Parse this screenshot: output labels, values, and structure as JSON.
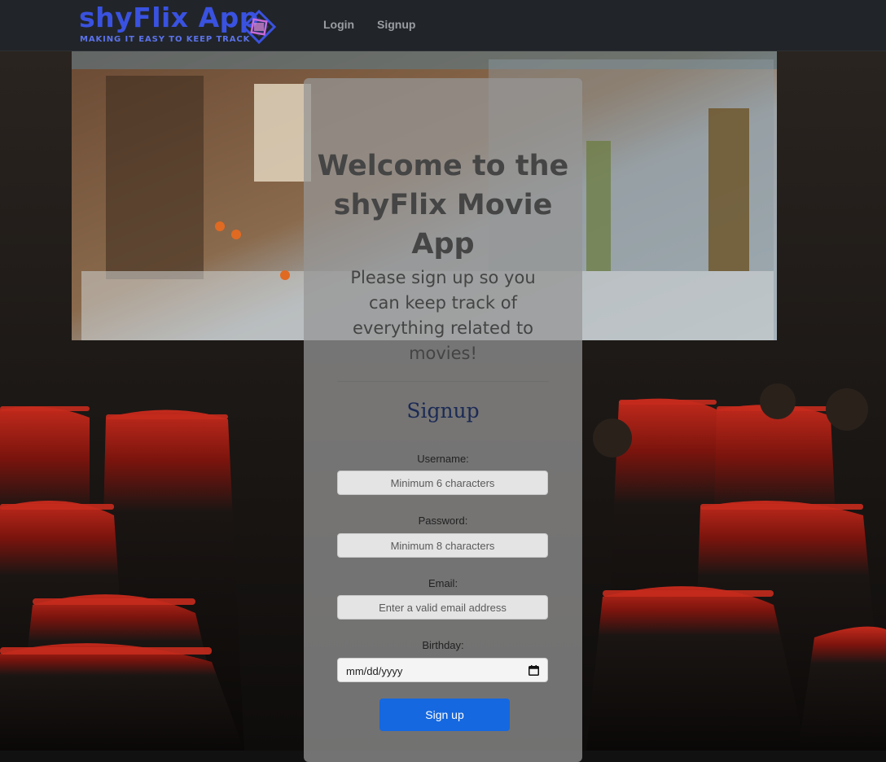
{
  "nav": {
    "brand_name": "shyFlix App",
    "brand_tagline": "MAKING IT EASY TO KEEP TRACK",
    "links": [
      "Login",
      "Signup"
    ]
  },
  "hero": {
    "title": "Welcome to the shyFlix Movie App",
    "subtitle": "Please sign up so you can keep track of everything related to movies!"
  },
  "form": {
    "heading": "Signup",
    "fields": [
      {
        "label": "Username:",
        "placeholder": "Minimum 6 characters",
        "type": "text"
      },
      {
        "label": "Password:",
        "placeholder": "Minimum 8 characters",
        "type": "password"
      },
      {
        "label": "Email:",
        "placeholder": "Enter a valid email address",
        "type": "email"
      },
      {
        "label": "Birthday:",
        "value": "mm/dd/yyyy",
        "type": "date",
        "icon": "calendar-icon"
      }
    ],
    "submit_label": "Sign up"
  },
  "colors": {
    "navbar": "#212529",
    "brand": "#3a52e0",
    "heading": "#1b2a55",
    "button": "#1568e0"
  }
}
